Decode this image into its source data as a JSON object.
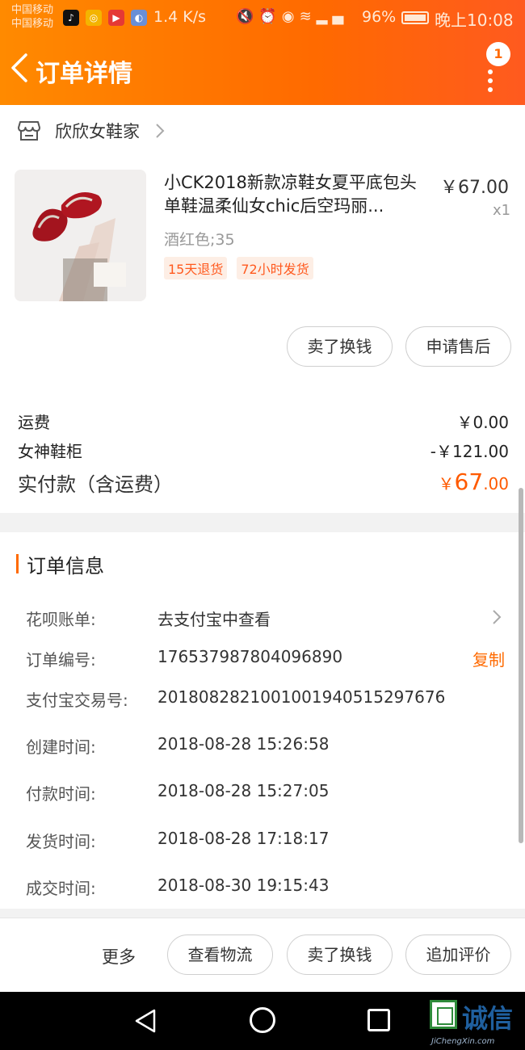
{
  "status_bar": {
    "carrier_1": "中国移动",
    "carrier_2": "中国移动",
    "speed": "1.4 K/s",
    "battery": "96%",
    "time": "晚上10:08"
  },
  "navbar": {
    "title": "订单详情",
    "badge_count": "1",
    "accent_color": "#ff6a00"
  },
  "shop": {
    "name": "欣欣女鞋家"
  },
  "product": {
    "title": "小CK2018新款凉鞋女夏平底包头单鞋温柔仙女chic后空玛丽...",
    "price": "￥67.00",
    "qty": "x1",
    "sku": "酒红色;35",
    "tags": [
      "15天退货",
      "72小时发货"
    ]
  },
  "item_actions": {
    "sell": "卖了换钱",
    "after_sale": "申请售后"
  },
  "fees": {
    "shipping_label": "运费",
    "shipping_value": "￥0.00",
    "cabinet_label": "女神鞋柜",
    "cabinet_value": "-￥121.00",
    "paid_label": "实付款（含运费）",
    "paid_currency": "￥",
    "paid_int": "67",
    "paid_dec": ".00"
  },
  "order_info": {
    "title": "订单信息",
    "rows": [
      {
        "label": "花呗账单:",
        "value": "去支付宝中查看"
      },
      {
        "label": "订单编号:",
        "value": "176537987804096890"
      },
      {
        "label": "支付宝交易号:",
        "value": "2018082821001001940515297676"
      },
      {
        "label": "创建时间:",
        "value": "2018-08-28 15:26:58"
      },
      {
        "label": "付款时间:",
        "value": "2018-08-28 15:27:05"
      },
      {
        "label": "发货时间:",
        "value": "2018-08-28 17:18:17"
      },
      {
        "label": "成交时间:",
        "value": "2018-08-30 19:15:43"
      }
    ],
    "copy_label": "复制"
  },
  "bottom_bar": {
    "more": "更多",
    "logistics": "查看物流",
    "sell": "卖了换钱",
    "review": "追加评价"
  },
  "watermark": {
    "text": "诚信",
    "sub": "JiChengXin.com"
  }
}
